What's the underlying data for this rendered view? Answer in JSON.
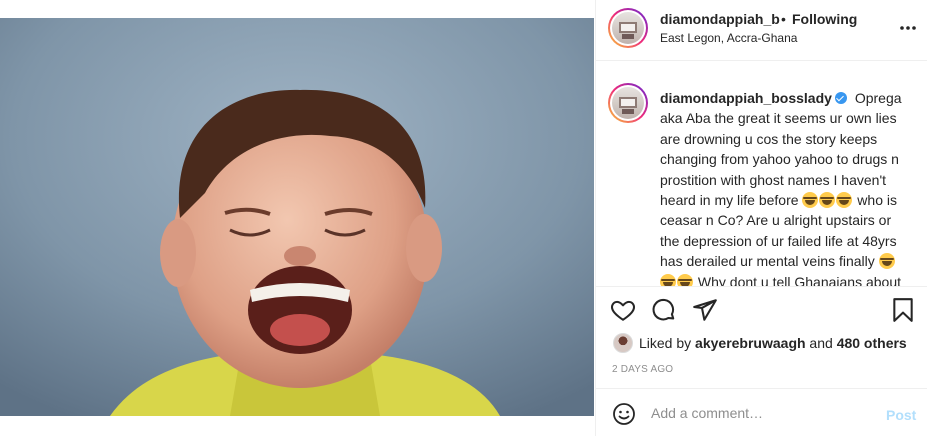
{
  "post": {
    "username_header": "diamondappiah_bossla",
    "separator": "•",
    "follow_status": "Following",
    "location": "East Legon, Accra-Ghana",
    "more_icon": "more-horizontal-icon"
  },
  "caption": {
    "username": "diamondappiah_bosslady",
    "verified_icon": "verified-badge-icon",
    "part1": " Oprega aka Aba the great it seems ur own lies are drowning u cos the story keeps changing from yahoo yahoo to drugs n prostition with ghost names I haven't heard in my life before ",
    "part2": " who is ceasar n Co? Are u alright upstairs or the depression of ur failed life at 48yrs has derailed ur mental veins finally ",
    "part3": " Why dont u tell Ghanaians about the money u had",
    "emoji_icon": "laughing-emoji-icon"
  },
  "actions": {
    "like_icon": "heart-icon",
    "comment_icon": "comment-icon",
    "share_icon": "share-icon",
    "save_icon": "bookmark-icon"
  },
  "likes": {
    "prefix": "Liked by ",
    "user": "akyerebruwaagh",
    "middle": " and ",
    "others": "480 others"
  },
  "timestamp": "2 DAYS AGO",
  "comment_box": {
    "emoji_icon": "smiley-icon",
    "placeholder": "Add a comment…",
    "post_label": "Post"
  },
  "colors": {
    "link_disabled": "#b2dffc",
    "verified": "#3897f0",
    "muted": "#8e8e8e"
  }
}
